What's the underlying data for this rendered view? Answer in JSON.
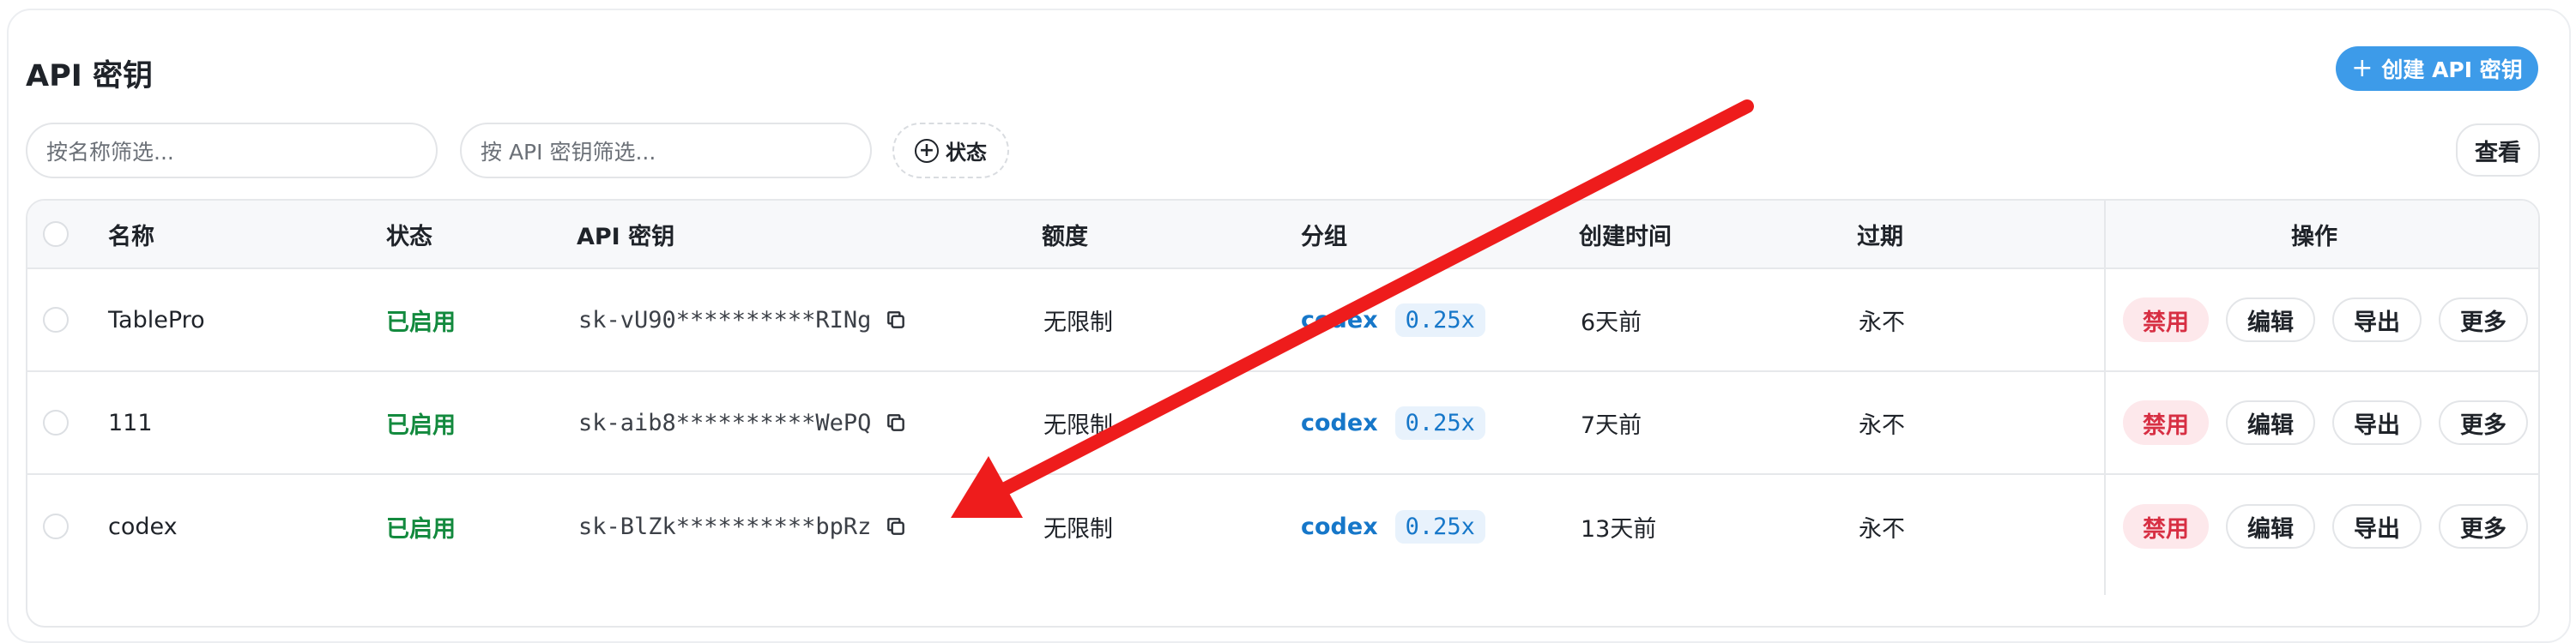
{
  "page": {
    "title": "API 密钥",
    "create_button": "创建 API 密钥"
  },
  "filters": {
    "name_placeholder": "按名称筛选...",
    "key_placeholder": "按 API 密钥筛选...",
    "status_label": "状态",
    "view_label": "查看"
  },
  "table": {
    "headers": {
      "name": "名称",
      "status": "状态",
      "key": "API 密钥",
      "quota": "额度",
      "group": "分组",
      "created": "创建时间",
      "expires": "过期",
      "actions": "操作"
    },
    "rows": [
      {
        "name": "TablePro",
        "status": "已启用",
        "key": "sk-vU90**********RINg",
        "quota": "无限制",
        "group": "codex",
        "ratio": "0.25x",
        "created": "6天前",
        "expires": "永不"
      },
      {
        "name": "111",
        "status": "已启用",
        "key": "sk-aib8**********WePQ",
        "quota": "无限制",
        "group": "codex",
        "ratio": "0.25x",
        "created": "7天前",
        "expires": "永不"
      },
      {
        "name": "codex",
        "status": "已启用",
        "key": "sk-BlZk**********bpRz",
        "quota": "无限制",
        "group": "codex",
        "ratio": "0.25x",
        "created": "13天前",
        "expires": "永不"
      }
    ],
    "actions": {
      "disable": "禁用",
      "edit": "编辑",
      "export": "导出",
      "more": "更多"
    }
  },
  "colors": {
    "accent": "#3d9be9",
    "status_on": "#138a3e",
    "danger": "#d72f43",
    "group": "#1677c9",
    "arrow": "#ee1c1c"
  },
  "icons": {
    "copy": "copy-icon",
    "plus": "plus-icon",
    "status_filter": "plus-circle-icon"
  }
}
